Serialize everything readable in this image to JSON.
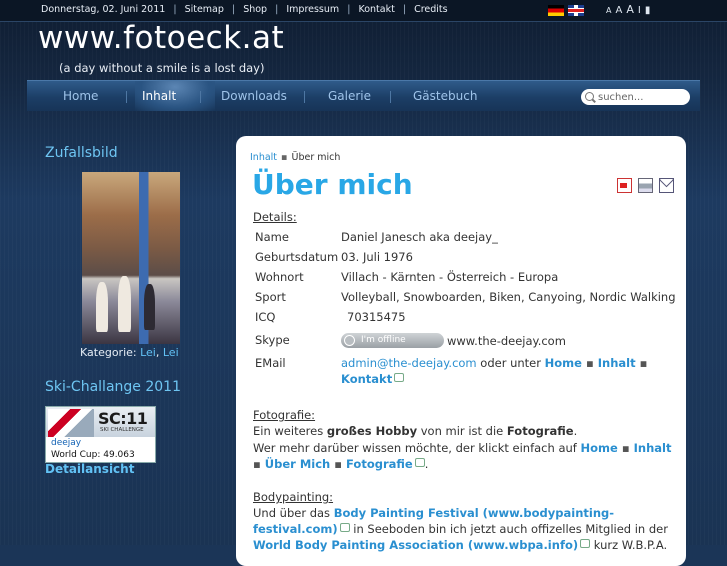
{
  "topbar": {
    "date": "Donnerstag, 02. Juni 2011",
    "links": [
      "Sitemap",
      "Shop",
      "Impressum",
      "Kontakt",
      "Credits"
    ],
    "separator": "|",
    "languages": [
      "de-flag-icon",
      "uk-flag-icon"
    ],
    "tools": [
      "A",
      "A",
      "A",
      "I",
      "▮"
    ]
  },
  "header": {
    "title": "www.fotoeck.at",
    "tagline": "(a day without a smile is a lost day)"
  },
  "nav": {
    "items": [
      "Home",
      "Inhalt",
      "Downloads",
      "Galerie",
      "Gästebuch"
    ],
    "active": "Inhalt"
  },
  "search": {
    "placeholder": "suchen..."
  },
  "sidebar": {
    "random_title": "Zufallsbild",
    "category_label": "Kategorie:",
    "category_links": [
      "Lei",
      "Lei"
    ],
    "ski_title": "Ski-Challange",
    "ski_year": "2011",
    "ski_banner": {
      "logo": "SC:11",
      "logo_sub": "SKI CHALLENGE",
      "user": "deejay",
      "worldcup": "World Cup: 49.063"
    },
    "detail_link": "Detailansicht"
  },
  "content": {
    "breadcrumb": [
      "Inhalt",
      "Über mich"
    ],
    "title": "Über mich",
    "details_heading": "Details:",
    "details": [
      {
        "label": "Name",
        "value": "Daniel Janesch aka deejay_"
      },
      {
        "label": "Geburtsdatum",
        "value": "03. Juli 1976"
      },
      {
        "label": "Wohnort",
        "value": "Villach - Kärnten - Österreich - Europa"
      },
      {
        "label": "Sport",
        "value": "Volleyball, Snowboarden, Biken, Canyoing, Nordic Walking"
      },
      {
        "label": "ICQ",
        "value": "70315475"
      }
    ],
    "skype": {
      "label": "Skype",
      "status": "I'm offline",
      "url": "www.the-deejay.com"
    },
    "email": {
      "label": "EMail",
      "address": "admin@the-deejay.com",
      "text": "oder unter",
      "links": [
        "Home",
        "Inhalt",
        "Kontakt"
      ]
    },
    "foto": {
      "heading": "Fotografie:",
      "line1_pre": "Ein weiteres",
      "line1_bold1": "großes Hobby",
      "line1_mid": "von mir ist die",
      "line1_bold2": "Fotografie",
      "line1_end": ".",
      "line2_pre": "Wer mehr darüber wissen möchte, der klickt einfach auf",
      "links": [
        "Home",
        "Inhalt",
        "Über Mich",
        "Fotografie"
      ]
    },
    "bodypainting": {
      "heading": "Bodypainting:",
      "line1_pre": "Und über das",
      "line1_link": "Body Painting Festival (www.bodypainting-",
      "line2_link": "festival.com)",
      "line2_text": "in Seeboden bin ich jetzt auch offizelles Mitglied in der",
      "line3_link": "World Body Painting Association (www.wbpa.info)",
      "line3_text": "kurz W.B.P.A."
    }
  }
}
